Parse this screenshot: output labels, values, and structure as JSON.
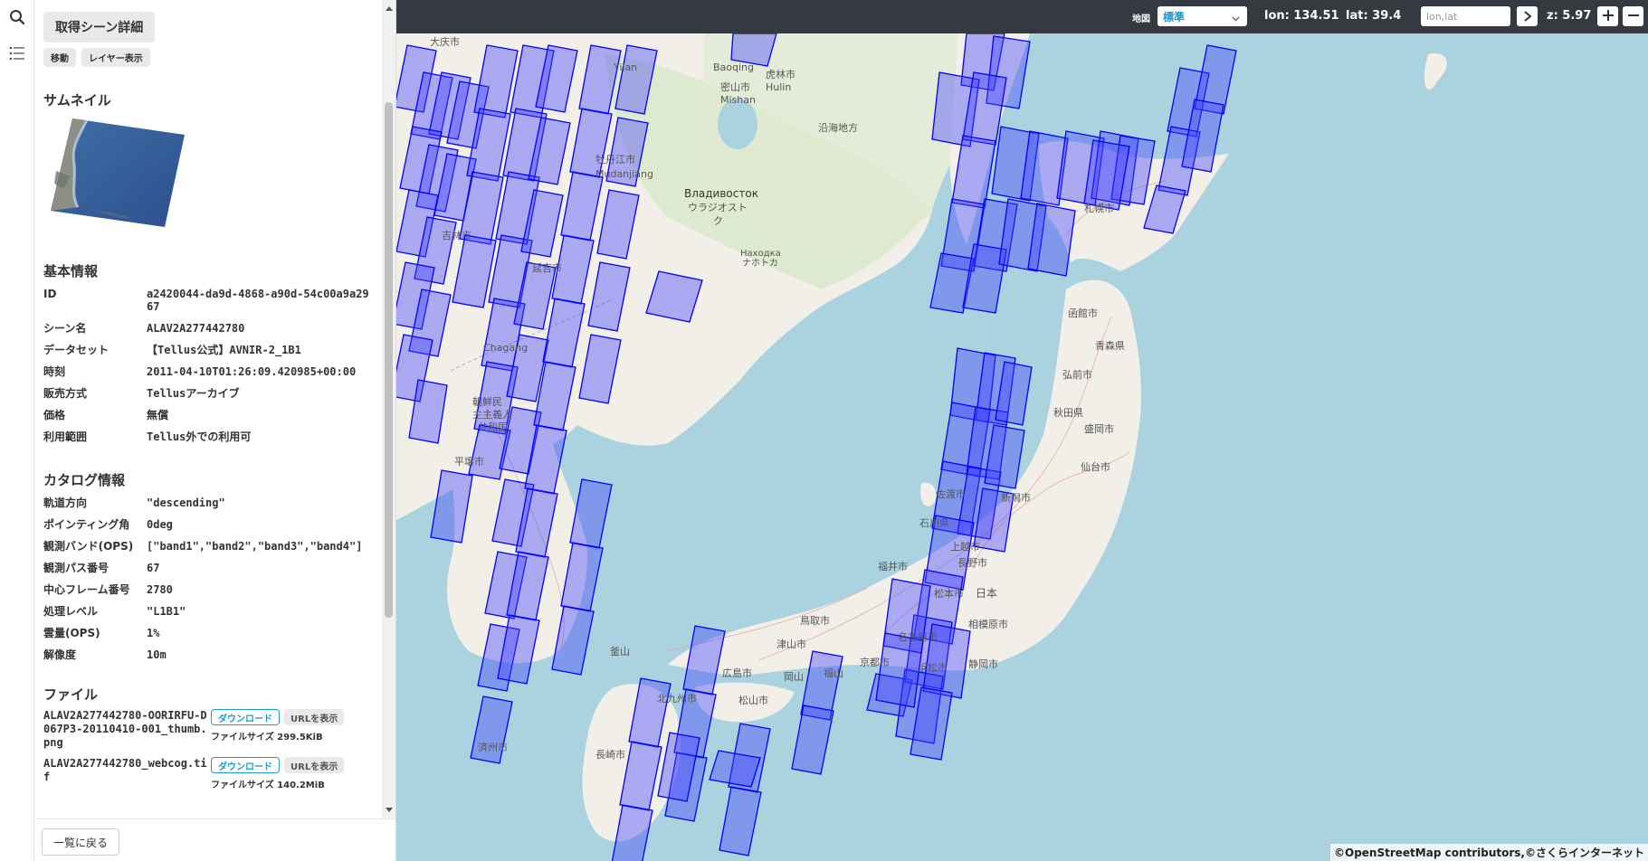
{
  "panel": {
    "detail_button": "取得シーン詳細",
    "move_button": "移動",
    "layer_button": "レイヤー表示",
    "thumbnail_heading": "サムネイル",
    "basic_heading": "基本情報",
    "basic_info": [
      {
        "key": "ID",
        "value": "a2420044-da9d-4868-a90d-54c00a9a2967"
      },
      {
        "key": "シーン名",
        "value": "ALAV2A277442780"
      },
      {
        "key": "データセット",
        "value": "【Tellus公式】AVNIR-2_1B1"
      },
      {
        "key": "時刻",
        "value": "2011-04-10T01:26:09.420985+00:00"
      },
      {
        "key": "販売方式",
        "value": "Tellusアーカイブ"
      },
      {
        "key": "価格",
        "value": "無償"
      },
      {
        "key": "利用範囲",
        "value": "Tellus外での利用可"
      }
    ],
    "catalog_heading": "カタログ情報",
    "catalog_info": [
      {
        "key": "軌道方向",
        "value": "\"descending\""
      },
      {
        "key": "ポインティング角",
        "value": "0deg"
      },
      {
        "key": "観測バンド(OPS)",
        "value": "[\"band1\",\"band2\",\"band3\",\"band4\"]"
      },
      {
        "key": "観測パス番号",
        "value": "67"
      },
      {
        "key": "中心フレーム番号",
        "value": "2780"
      },
      {
        "key": "処理レベル",
        "value": "\"L1B1\""
      },
      {
        "key": "雲量(OPS)",
        "value": "1%"
      },
      {
        "key": "解像度",
        "value": "10m"
      }
    ],
    "files_heading": "ファイル",
    "files": [
      {
        "name": "ALAV2A277442780-OORIRFU-D067P3-20110410-001_thumb.png",
        "download": "ダウンロード",
        "url": "URLを表示",
        "size": "ファイルサイズ 299.5KiB"
      },
      {
        "name": "ALAV2A277442780_webcog.tif",
        "download": "ダウンロード",
        "url": "URLを表示",
        "size": "ファイルサイズ 140.2MiB"
      }
    ],
    "back_button": "一覧に戻る"
  },
  "toolbar": {
    "map_label": "地図",
    "map_selected": "標準",
    "lon": "lon: 134.51",
    "lat": "lat: 39.4",
    "coord_placeholder": "lon,lat",
    "zoom": "z: 5.97"
  },
  "map": {
    "labels": [
      "大庆市",
      "Yilan",
      "Baoqing",
      "虎林市",
      "Hulin",
      "密山市",
      "Mishan",
      "沿海地方",
      "牡丹江市",
      "Mudanjiang",
      "Владивосток",
      "ウラジオスト",
      "ク",
      "Находка",
      "ナホトカ",
      "吉林市",
      "延吉市",
      "Chagang",
      "朝鮮民",
      "主主義人",
      "共和国",
      "平壌市",
      "釜山",
      "札幌市",
      "函館市",
      "青森県",
      "弘前市",
      "秋田県",
      "盛岡市",
      "仙台市",
      "新潟市",
      "佐渡市",
      "石川県",
      "福井市",
      "長野市",
      "上越市",
      "日本",
      "松本市",
      "名古屋市",
      "京都市",
      "浜松市",
      "静岡市",
      "相模原市",
      "鳥取市",
      "広島市",
      "松山市",
      "北九州市",
      "長崎市",
      "津山市",
      "岡山",
      "福山",
      "済州市"
    ],
    "attribution": "©OpenStreetMap contributors,©さくらインターネット"
  },
  "colors": {
    "toolbar_bg": "#343a40",
    "sea": "#aad3df",
    "land": "#f2efe9",
    "land_green": "#d8e8c8",
    "footprint_stroke": "#0000ff",
    "footprint_fill": "rgba(64,64,255,0.4)",
    "accent": "#1a9bd7"
  },
  "icons": [
    "search-icon",
    "list-icon",
    "chevron-down-icon",
    "arrow-right-icon",
    "plus-icon",
    "minus-icon"
  ]
}
